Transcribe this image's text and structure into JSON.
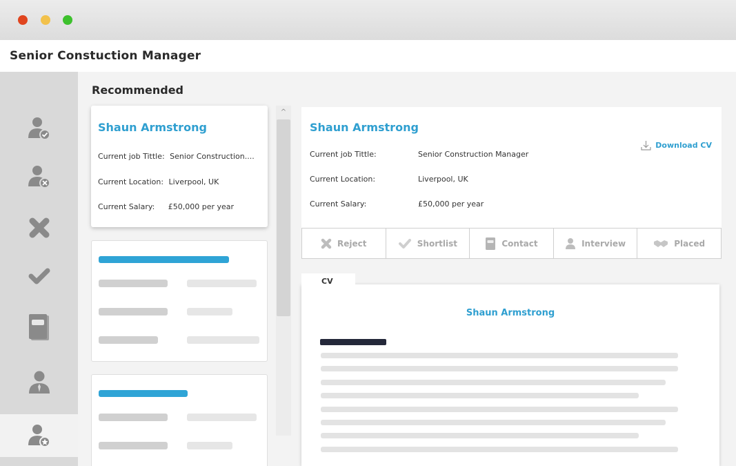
{
  "window": {
    "controls": [
      "close",
      "minimize",
      "maximize"
    ],
    "title": "Senior Constuction Manager"
  },
  "sidebar": {
    "items": [
      {
        "icon": "user-check-icon",
        "active": false
      },
      {
        "icon": "user-remove-icon",
        "active": false
      },
      {
        "icon": "reject-x-icon",
        "active": false
      },
      {
        "icon": "checkmark-icon",
        "active": false
      },
      {
        "icon": "contact-book-icon",
        "active": false
      },
      {
        "icon": "interview-person-icon",
        "active": false
      },
      {
        "icon": "user-star-icon",
        "active": true
      }
    ]
  },
  "section": {
    "title": "Recommended"
  },
  "candidate_card": {
    "name": "Shaun Armstrong",
    "job_label": "Current job Tittle:",
    "job_value": "Senior Construction....",
    "location_label": "Current Location:",
    "location_value": "Liverpool, UK",
    "salary_label": "Current Salary:",
    "salary_value": "£50,000 per year"
  },
  "detail": {
    "name": "Shaun Armstrong",
    "job_label": "Current job Tittle:",
    "job_value": "Senior Construction Manager",
    "location_label": "Current Location:",
    "location_value": "Liverpool, UK",
    "salary_label": "Current Salary:",
    "salary_value": "£50,000 per year",
    "download_label": "Download CV"
  },
  "actions": [
    {
      "label": "Reject",
      "icon": "x-icon"
    },
    {
      "label": "Shortlist",
      "icon": "check-icon"
    },
    {
      "label": "Contact",
      "icon": "book-icon"
    },
    {
      "label": "Interview",
      "icon": "person-icon"
    },
    {
      "label": "Placed",
      "icon": "handshake-icon"
    }
  ],
  "cv": {
    "tab_label": "CV",
    "name": "Shaun Armstrong"
  },
  "colors": {
    "accent": "#2f9fd0",
    "sidebar_bg": "#d9d9d9",
    "icon_gray": "#8a8a8a",
    "action_gray": "#a9a9a9"
  }
}
